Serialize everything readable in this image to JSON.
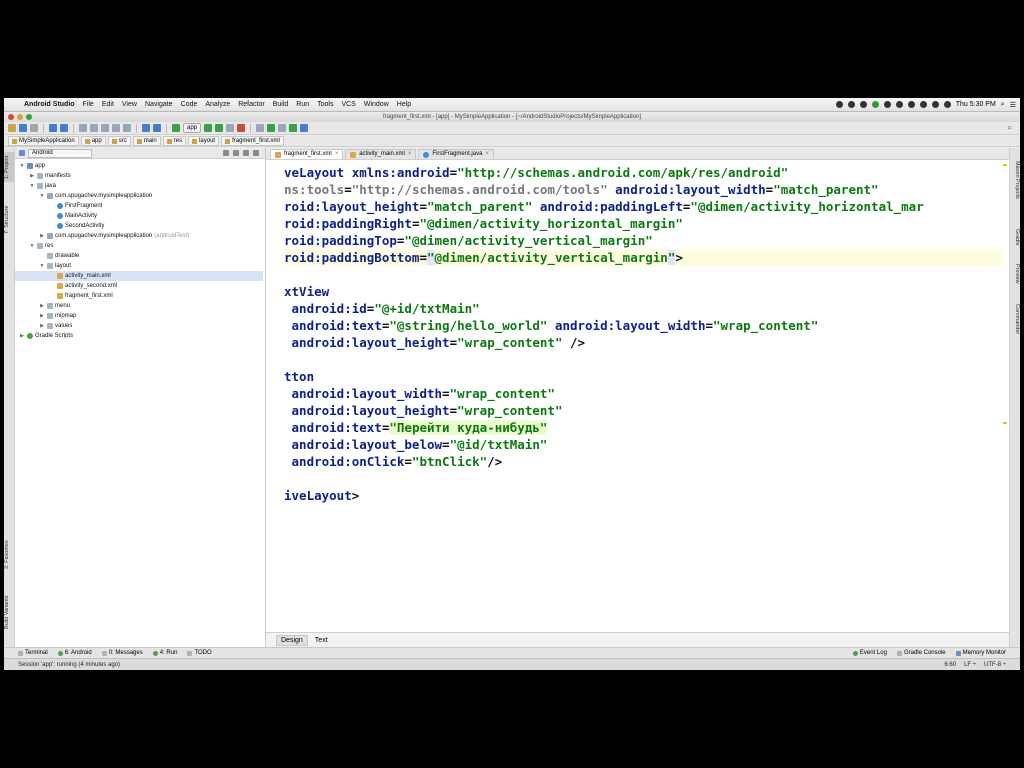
{
  "menubar": {
    "app_name": "Android Studio",
    "items": [
      "File",
      "Edit",
      "View",
      "Navigate",
      "Code",
      "Analyze",
      "Refactor",
      "Build",
      "Run",
      "Tools",
      "VCS",
      "Window",
      "Help"
    ],
    "clock": "Thu 5:30 PM"
  },
  "window": {
    "title": "fragment_first.xml - [app] - MySimpleApplication - [~/AndroidStudioProjects/MySimpleApplication]"
  },
  "toolbar": {
    "run_config": "app"
  },
  "breadcrumb": [
    "MySimpleApplication",
    "app",
    "src",
    "main",
    "res",
    "layout",
    "fragment_first.xml"
  ],
  "project_panel": {
    "view_mode": "Android",
    "side_tabs": [
      "1: Project",
      "7: Structure",
      "2: Favorites",
      "Build Variants"
    ],
    "tree": [
      {
        "label": "app",
        "depth": 0,
        "icon": "module-icon",
        "arrow": "▼"
      },
      {
        "label": "manifests",
        "depth": 1,
        "icon": "folder-icon",
        "arrow": "▶"
      },
      {
        "label": "java",
        "depth": 1,
        "icon": "folder-icon",
        "arrow": "▼"
      },
      {
        "label": "com.spugachev.mysimpleapplication",
        "depth": 2,
        "icon": "package-icon",
        "arrow": "▼"
      },
      {
        "label": "FirstFragment",
        "depth": 3,
        "icon": "class-icon",
        "arrow": ""
      },
      {
        "label": "MainActivity",
        "depth": 3,
        "icon": "class-icon",
        "arrow": ""
      },
      {
        "label": "SecondActivity",
        "depth": 3,
        "icon": "class-icon",
        "arrow": ""
      },
      {
        "label": "com.spugachev.mysimpleapplication",
        "suffix": "(androidTest)",
        "depth": 2,
        "icon": "package-icon",
        "arrow": "▶"
      },
      {
        "label": "res",
        "depth": 1,
        "icon": "folder-icon",
        "arrow": "▼"
      },
      {
        "label": "drawable",
        "depth": 2,
        "icon": "folder-icon",
        "arrow": ""
      },
      {
        "label": "layout",
        "depth": 2,
        "icon": "folder-icon",
        "arrow": "▼"
      },
      {
        "label": "activity_main.xml",
        "depth": 3,
        "icon": "xml-icon",
        "arrow": "",
        "selected": true
      },
      {
        "label": "activity_second.xml",
        "depth": 3,
        "icon": "xml-icon",
        "arrow": ""
      },
      {
        "label": "fragment_first.xml",
        "depth": 3,
        "icon": "xml-icon",
        "arrow": ""
      },
      {
        "label": "menu",
        "depth": 2,
        "icon": "folder-icon",
        "arrow": "▶"
      },
      {
        "label": "mipmap",
        "depth": 2,
        "icon": "folder-icon",
        "arrow": "▶"
      },
      {
        "label": "values",
        "depth": 2,
        "icon": "folder-icon",
        "arrow": "▶"
      },
      {
        "label": "Gradle Scripts",
        "depth": 0,
        "icon": "gradle-icon",
        "arrow": "▶"
      }
    ]
  },
  "editor": {
    "tabs": [
      {
        "label": "fragment_first.xml",
        "active": true
      },
      {
        "label": "activity_main.xml",
        "active": false
      },
      {
        "label": "FirstFragment.java",
        "active": false
      }
    ],
    "lines": [
      [
        [
          "tg",
          "veLayout "
        ],
        [
          "at",
          "xmlns:android"
        ],
        [
          "pu",
          "="
        ],
        [
          "st",
          "\"http://schemas.android.com/apk/res/android\""
        ]
      ],
      [
        [
          "ns",
          "ns:tools"
        ],
        [
          "pu",
          "="
        ],
        [
          "ns",
          "\"http://schemas.android.com/tools\" "
        ],
        [
          "at",
          "android:layout_width"
        ],
        [
          "pu",
          "="
        ],
        [
          "st",
          "\"match_parent\""
        ]
      ],
      [
        [
          "at",
          "roid:layout_height"
        ],
        [
          "pu",
          "="
        ],
        [
          "st",
          "\"match_parent\" "
        ],
        [
          "at",
          "android:paddingLeft"
        ],
        [
          "pu",
          "="
        ],
        [
          "st",
          "\"@dimen/activity_horizontal_mar"
        ]
      ],
      [
        [
          "at",
          "roid:paddingRight"
        ],
        [
          "pu",
          "="
        ],
        [
          "st",
          "\"@dimen/activity_horizontal_margin\""
        ]
      ],
      [
        [
          "at",
          "roid:paddingTop"
        ],
        [
          "pu",
          "="
        ],
        [
          "st",
          "\"@dimen/activity_vertical_margin\""
        ]
      ],
      [
        [
          "at",
          "roid:paddingBottom"
        ],
        [
          "pu",
          "="
        ],
        [
          "hl",
          "\""
        ],
        [
          "st",
          "@dimen/activity_vertical_margin"
        ],
        [
          "hl",
          "\""
        ],
        [
          "pu",
          ">"
        ]
      ],
      [],
      [
        [
          "tg",
          "xtView"
        ]
      ],
      [
        [
          "at",
          " android:id"
        ],
        [
          "pu",
          "="
        ],
        [
          "st",
          "\"@+id/txtMain\""
        ]
      ],
      [
        [
          "at",
          " android:text"
        ],
        [
          "pu",
          "="
        ],
        [
          "st",
          "\"@string/hello_world\" "
        ],
        [
          "at",
          "android:layout_width"
        ],
        [
          "pu",
          "="
        ],
        [
          "st",
          "\"wrap_content\""
        ]
      ],
      [
        [
          "at",
          " android:layout_height"
        ],
        [
          "pu",
          "="
        ],
        [
          "st",
          "\"wrap_content\" "
        ],
        [
          "pu",
          "/>"
        ]
      ],
      [],
      [
        [
          "tg",
          "tton"
        ]
      ],
      [
        [
          "at",
          " android:layout_width"
        ],
        [
          "pu",
          "="
        ],
        [
          "st",
          "\"wrap_content\""
        ]
      ],
      [
        [
          "at",
          " android:layout_height"
        ],
        [
          "pu",
          "="
        ],
        [
          "st",
          "\"wrap_content\""
        ]
      ],
      [
        [
          "at",
          " android:text"
        ],
        [
          "pu",
          "="
        ],
        [
          "ru",
          "\"Перейти куда-нибудь\""
        ]
      ],
      [
        [
          "at",
          " android:layout_below"
        ],
        [
          "pu",
          "="
        ],
        [
          "st",
          "\"@id/txtMain\""
        ]
      ],
      [
        [
          "at",
          " android:onClick"
        ],
        [
          "pu",
          "="
        ],
        [
          "st",
          "\"btnClick\""
        ],
        [
          "pu",
          "/>"
        ]
      ],
      [],
      [
        [
          "tg",
          "iveLayout"
        ],
        [
          "pu",
          ">"
        ]
      ]
    ],
    "current_line": 5,
    "design_tabs": [
      {
        "label": "Design",
        "active": true
      },
      {
        "label": "Text",
        "active": false
      }
    ]
  },
  "right_strip_tabs": [
    "Maven Projects",
    "Gradle",
    "Preview",
    "Commander"
  ],
  "bottom_tools": {
    "left": [
      {
        "label": "Terminal",
        "icon": "terminal-icon"
      },
      {
        "label": "6: Android",
        "icon": "android-icon"
      },
      {
        "label": "0: Messages",
        "icon": "messages-icon"
      },
      {
        "label": "4: Run",
        "icon": "run-icon"
      },
      {
        "label": "TODO",
        "icon": "todo-icon"
      }
    ],
    "right": [
      {
        "label": "Event Log",
        "icon": "event-log-icon"
      },
      {
        "label": "Gradle Console",
        "icon": "gradle-console-icon"
      },
      {
        "label": "Memory Monitor",
        "icon": "memory-monitor-icon"
      }
    ]
  },
  "status": {
    "message": "Session 'app': running (4 minutes ago)",
    "position": "6:60",
    "line_sep": "LF ÷",
    "encoding": "UTF-8 ÷"
  },
  "colors": {
    "tag": "#0b1f8f",
    "string": "#0a7a10",
    "selection": "#d6e2f5",
    "current_line": "#fffde0"
  }
}
